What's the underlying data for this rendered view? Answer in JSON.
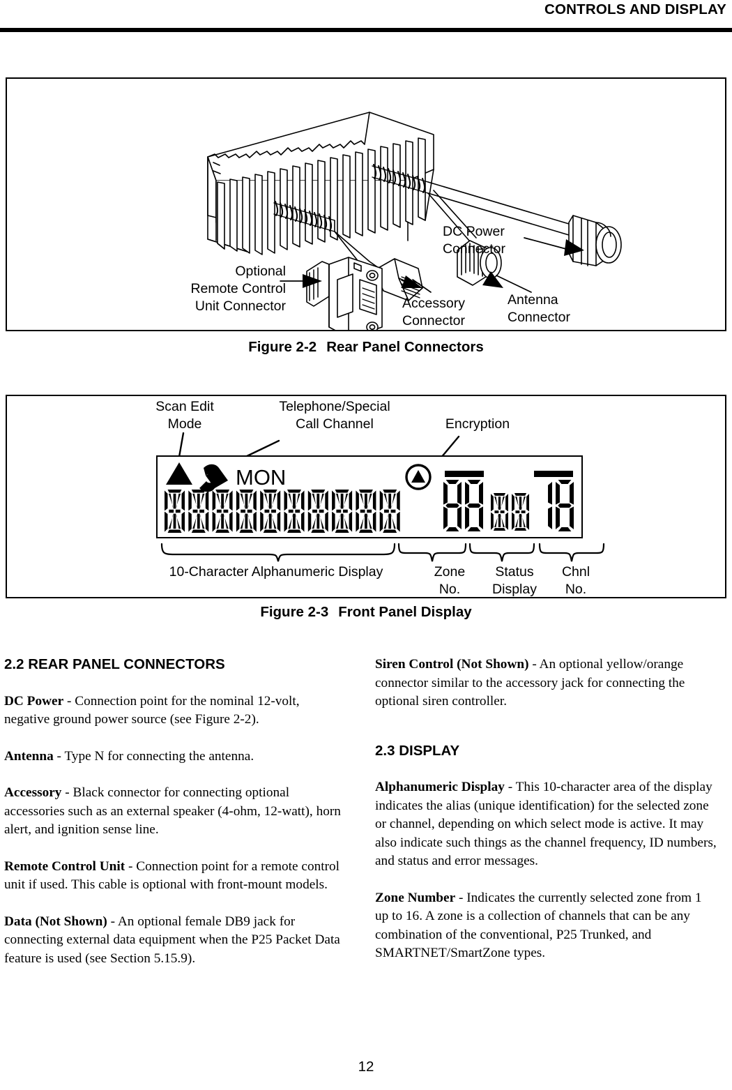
{
  "header": {
    "running_head": "CONTROLS AND DISPLAY"
  },
  "figure_2_2": {
    "caption_number": "Figure 2-2",
    "caption_title": "Rear Panel Connectors",
    "labels": {
      "remote_line1": "Optional",
      "remote_line2": "Remote Control",
      "remote_line3": "Unit Connector",
      "dc_power_line1": "DC Power",
      "dc_power_line2": "Connector",
      "accessory_line1": "Accessory",
      "accessory_line2": "Connector",
      "antenna_line1": "Antenna",
      "antenna_line2": "Connector"
    }
  },
  "figure_2_3": {
    "caption_number": "Figure 2-3",
    "caption_title": "Front Panel Display",
    "callouts": {
      "scan_edit_line1": "Scan Edit",
      "scan_edit_line2": "Mode",
      "telephone_line1": "Telephone/Special",
      "telephone_line2": "Call Channel",
      "encryption": "Encryption"
    },
    "lcd": {
      "mon_indicator": "MON",
      "alphanumeric_cell_count": 10,
      "zone_digits": 2,
      "status_cells": 2,
      "channel_digits": 2
    },
    "brace_labels": {
      "alphanumeric": "10-Character Alphanumeric Display",
      "zone_line1": "Zone",
      "zone_line2": "No.",
      "status_line1": "Status",
      "status_line2": "Display",
      "chnl_line1": "Chnl",
      "chnl_line2": "No."
    }
  },
  "left_column": {
    "section_heading": "2.2 REAR PANEL CONNECTORS",
    "paragraphs": [
      {
        "term": "DC Power",
        "dash": " - ",
        "text": "Connection point for the nominal 12-volt, negative ground power source (see Figure 2-2)."
      },
      {
        "term": "Antenna",
        "dash": " - ",
        "text": "Type N for connecting the antenna."
      },
      {
        "term": "Accessory",
        "dash": " - ",
        "text": "Black connector for connecting optional accessories such as an external speaker (4-ohm, 12-watt), horn alert, and ignition sense line."
      },
      {
        "term": "Remote Control Unit",
        "dash": " - ",
        "text": "Connection point for a remote control unit if used. This cable is optional with front-mount models."
      },
      {
        "term": "Data (Not Shown)",
        "dash": " - ",
        "text": "An optional female DB9 jack for connecting external data equipment when the P25 Packet Data feature is used (see Section 5.15.9)."
      }
    ]
  },
  "right_column": {
    "paragraph_top": {
      "term": "Siren Control (Not Shown)",
      "dash": " - ",
      "text": "An optional yellow/orange connector similar to the accessory jack for connecting the optional siren controller."
    },
    "section_heading": "2.3 DISPLAY",
    "paragraphs": [
      {
        "term": "Alphanumeric Display",
        "dash": " - ",
        "text": "This 10-character area of the display indicates the alias (unique identification) for the selected zone or channel, depending on which select mode is active. It may also indicate such things as the channel frequency, ID numbers, and status and error messages."
      },
      {
        "term": "Zone Number",
        "dash": " - ",
        "text": "Indicates the currently selected zone from 1 up to 16. A zone is a collection of channels that can be any combination of the conventional, P25 Trunked, and SMARTNET/SmartZone types."
      }
    ]
  },
  "footer": {
    "page_number": "12"
  }
}
